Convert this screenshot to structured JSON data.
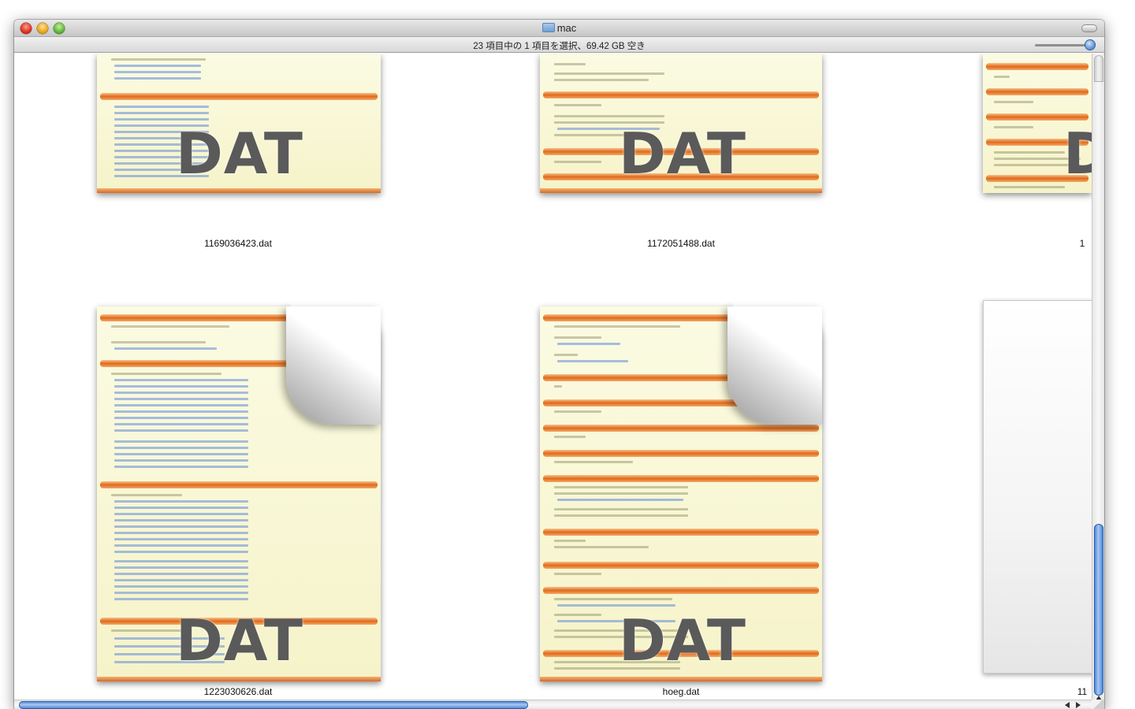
{
  "window": {
    "title": "mac",
    "status": "23 項目中の 1 項目を選択、69.42 GB 空き"
  },
  "files": [
    {
      "name": "1169036423.dat",
      "badge": "DAT"
    },
    {
      "name": "1172051488.dat",
      "badge": "DAT"
    },
    {
      "name": "1",
      "badge": "D"
    },
    {
      "name": "1223030626.dat",
      "badge": "DAT"
    },
    {
      "name": "hoeg.dat",
      "badge": "DAT"
    },
    {
      "name": "11",
      "badge": ""
    }
  ],
  "icons": [
    "folder-icon",
    "document-preview-icon",
    "page-curl-icon"
  ],
  "colors": {
    "accent": "#3d7bd0",
    "preview_band": "#e06a1a",
    "preview_paper": "#f6f3c9"
  }
}
